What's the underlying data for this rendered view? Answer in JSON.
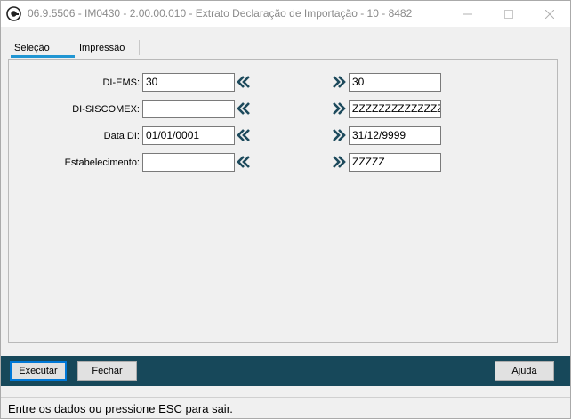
{
  "window": {
    "title": "06.9.5506 - IM0430 - 2.00.00.010 - Extrato Declaração de Importação - 10 - 8482"
  },
  "tabs": [
    {
      "label": "Seleção",
      "active": true
    },
    {
      "label": "Impressão",
      "active": false
    }
  ],
  "form": {
    "rows": [
      {
        "label": "DI-EMS:",
        "from": "30",
        "to": "30"
      },
      {
        "label": "DI-SISCOMEX:",
        "from": "",
        "to": "ZZZZZZZZZZZZZZZ"
      },
      {
        "label": "Data DI:",
        "from": "01/01/0001",
        "to": "31/12/9999"
      },
      {
        "label": "Estabelecimento:",
        "from": "",
        "to": "ZZZZZ"
      }
    ]
  },
  "buttons": {
    "executar": "Executar",
    "fechar": "Fechar",
    "ajuda": "Ajuda"
  },
  "status": {
    "text": "Entre os dados ou pressione ESC para sair."
  },
  "colors": {
    "accent_tab": "#2196d3",
    "bottom_bar": "#17485a",
    "arrow": "#1d4a5c"
  },
  "icons": {
    "left": "double-chevron-left-icon",
    "right": "double-chevron-right-icon"
  }
}
